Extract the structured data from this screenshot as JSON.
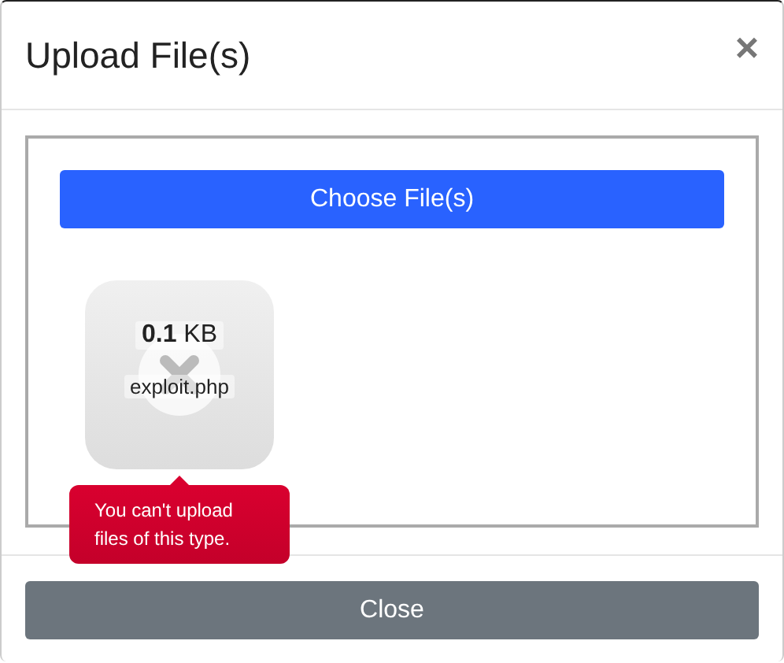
{
  "dialog": {
    "title": "Upload File(s)",
    "close_icon": "×"
  },
  "dropzone": {
    "button": "Choose File(s)",
    "files": [
      {
        "size": "**0.1** KB",
        "name": "exploit.php",
        "error": true,
        "message": "You can't upload files of this type."
      }
    ]
  },
  "footer": {
    "button": "Close"
  }
}
